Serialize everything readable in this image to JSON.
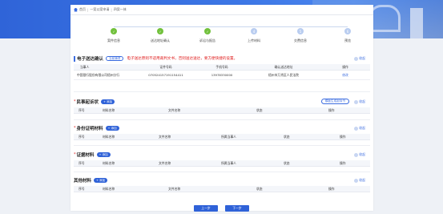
{
  "breadcrumb": [
    "首页",
    "一案以案申请",
    "四案一体"
  ],
  "steps": [
    {
      "num": "1",
      "label": "案件信息",
      "status": "done"
    },
    {
      "num": "2",
      "label": "送达地址确认",
      "status": "done"
    },
    {
      "num": "3",
      "label": "诉讼与报告",
      "status": "done"
    },
    {
      "num": "4",
      "label": "上传材料",
      "status": "todo"
    },
    {
      "num": "5",
      "label": "交费信息",
      "status": "todo"
    },
    {
      "num": "6",
      "label": "预览",
      "status": "todo"
    }
  ],
  "collapse_label": "收起",
  "add_label": "添加",
  "delivery": {
    "title": "电子送达确认",
    "chip": "当前事项",
    "warning": "电子送达原则不适用裁判文书，否则送达送达，要方便快捷的设置。",
    "headers": [
      "当事人",
      "证件号码",
      "手机号码",
      "确认送达地址",
      "操作"
    ],
    "row": {
      "party": "中国银行股份有限公司梧州分行",
      "id": "070524157191154411",
      "phone": "13978330000",
      "address": "梧州市万秀区人民法院",
      "action": "修改"
    }
  },
  "complaint": {
    "title": "民事起诉状",
    "gen_button": "模板生成起诉书",
    "headers": [
      "序号",
      "材料名称",
      "文件名称",
      "状态",
      "操作"
    ]
  },
  "identity": {
    "title": "身份证明材料",
    "headers": [
      "序号",
      "材料名称",
      "文件名称",
      "所属当事人",
      "状态",
      "操作"
    ]
  },
  "evidence": {
    "title": "证据材料",
    "headers": [
      "序号",
      "材料名称",
      "文件名称",
      "所属当事人",
      "状态",
      "操作"
    ]
  },
  "other": {
    "title": "其他材料",
    "headers": [
      "序号",
      "材料名称",
      "文件名称",
      "状态",
      "操作"
    ]
  },
  "footer": {
    "prev": "上一步",
    "next": "下一步"
  }
}
